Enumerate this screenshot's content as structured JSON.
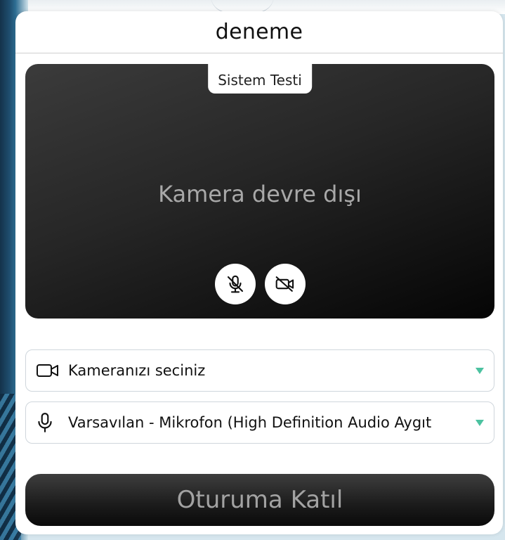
{
  "header": {
    "title": "deneme"
  },
  "preview": {
    "badge": "Sistem Testi",
    "status_text": "Kamera devre dışı",
    "controls": [
      {
        "icon": "mic-off-icon"
      },
      {
        "icon": "camera-off-icon"
      }
    ]
  },
  "devices": {
    "camera": {
      "icon": "video-camera-icon",
      "selected": "Kameranızı seciniz"
    },
    "microphone": {
      "icon": "microphone-icon",
      "selected": "Varsavılan - Mikrofon (High Definition Audio Aygıt"
    }
  },
  "join_button": {
    "label": "Oturuma Katıl"
  },
  "colors": {
    "caret": "#4cc2a0",
    "card_background": "#ffffff",
    "preview_background": "#1e1e1e"
  }
}
